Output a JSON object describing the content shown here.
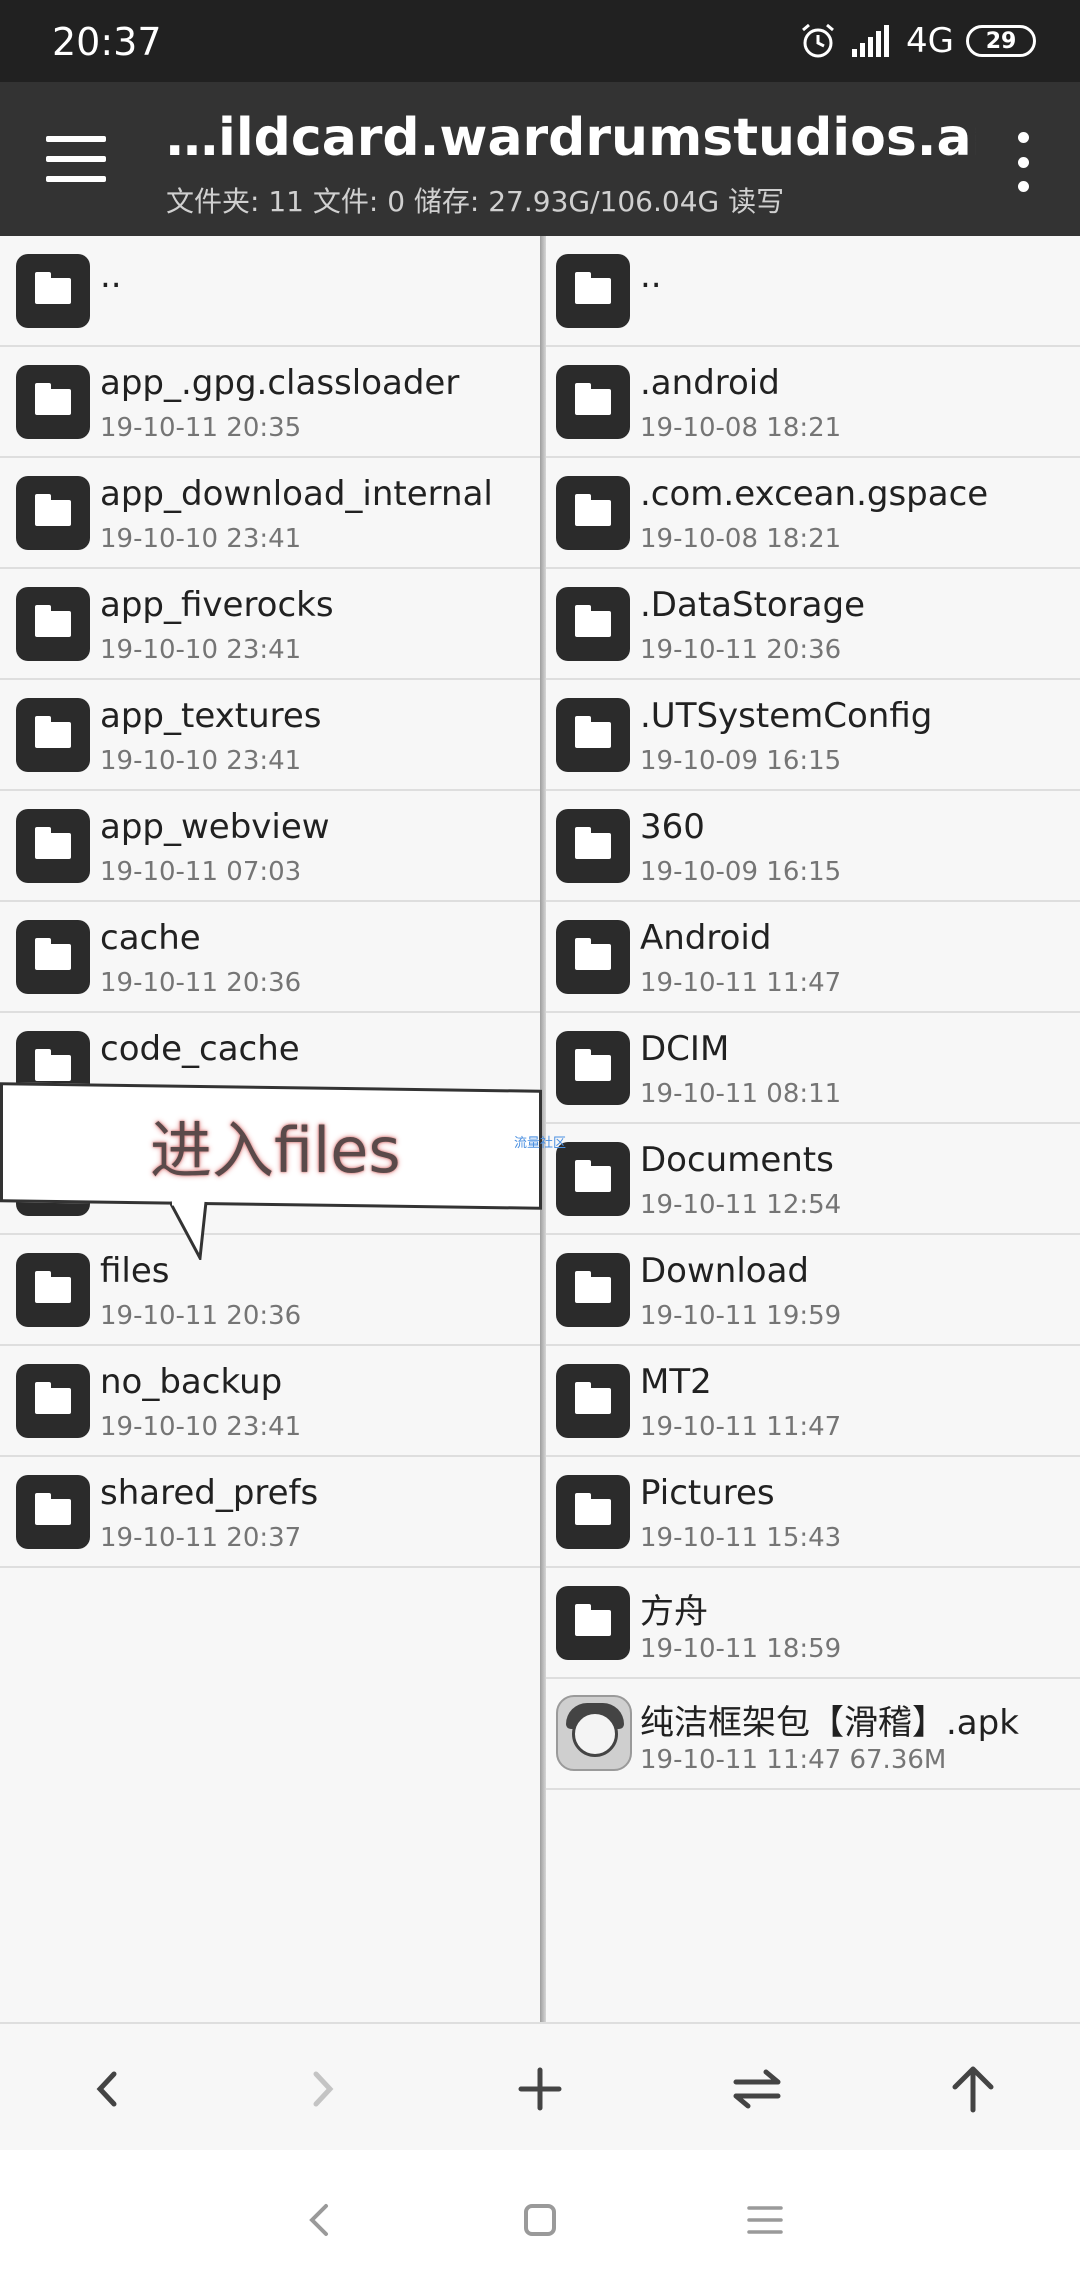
{
  "status_bar": {
    "time": "20:37",
    "network": "4G",
    "battery": "29",
    "icons": [
      "alarm-icon",
      "signal-icon",
      "battery-icon"
    ]
  },
  "app_bar": {
    "title": "…ildcard.wardrumstudios.ark/",
    "subtitle": "文件夹: 11  文件: 0  储存: 27.93G/106.04G  读写",
    "icons": [
      "menu-icon",
      "overflow-menu-icon"
    ]
  },
  "left_pane": {
    "parent": "..",
    "items": [
      {
        "name": "app_.gpg.classloader",
        "meta": "19-10-11 20:35"
      },
      {
        "name": "app_download_internal",
        "meta": "19-10-10 23:41"
      },
      {
        "name": "app_fiverocks",
        "meta": "19-10-10 23:41"
      },
      {
        "name": "app_textures",
        "meta": "19-10-10 23:41"
      },
      {
        "name": "app_webview",
        "meta": "19-10-11 07:03"
      },
      {
        "name": "cache",
        "meta": "19-10-11 20:36"
      },
      {
        "name": "code_cache",
        "meta": ""
      },
      {
        "name": "",
        "meta": ""
      },
      {
        "name": "files",
        "meta": "19-10-11 20:36"
      },
      {
        "name": "no_backup",
        "meta": "19-10-10 23:41"
      },
      {
        "name": "shared_prefs",
        "meta": "19-10-11 20:37"
      }
    ]
  },
  "right_pane": {
    "parent": "..",
    "items": [
      {
        "name": ".android",
        "meta": "19-10-08 18:21"
      },
      {
        "name": ".com.excean.gspace",
        "meta": "19-10-08 18:21"
      },
      {
        "name": ".DataStorage",
        "meta": "19-10-11 20:36"
      },
      {
        "name": ".UTSystemConfig",
        "meta": "19-10-09 16:15"
      },
      {
        "name": "360",
        "meta": "19-10-09 16:15"
      },
      {
        "name": "Android",
        "meta": "19-10-11 11:47"
      },
      {
        "name": "DCIM",
        "meta": "19-10-11 08:11"
      },
      {
        "name": "Documents",
        "meta": "19-10-11 12:54"
      },
      {
        "name": "Download",
        "meta": "19-10-11 19:59"
      },
      {
        "name": "MT2",
        "meta": "19-10-11 11:47"
      },
      {
        "name": "Pictures",
        "meta": "19-10-11 15:43"
      },
      {
        "name": "方舟",
        "meta": "19-10-11 18:59"
      }
    ],
    "apk": {
      "name": "纯洁框架包【滑稽】.apk",
      "meta": "19-10-11 11:47  67.36M"
    }
  },
  "overlay": {
    "callout_text": "进入files",
    "watermark": "流量社区"
  },
  "bottom_toolbar": {
    "icons": [
      "back-arrow-icon",
      "forward-arrow-icon",
      "add-icon",
      "swap-icon",
      "up-arrow-icon"
    ]
  },
  "system_nav": {
    "icons": [
      "nav-back-icon",
      "nav-home-icon",
      "nav-recents-icon"
    ]
  },
  "colors": {
    "status_bar": "#212121",
    "app_bar": "#333333",
    "icon_tile": "#2b2b2b",
    "background": "#f7f7f7"
  }
}
